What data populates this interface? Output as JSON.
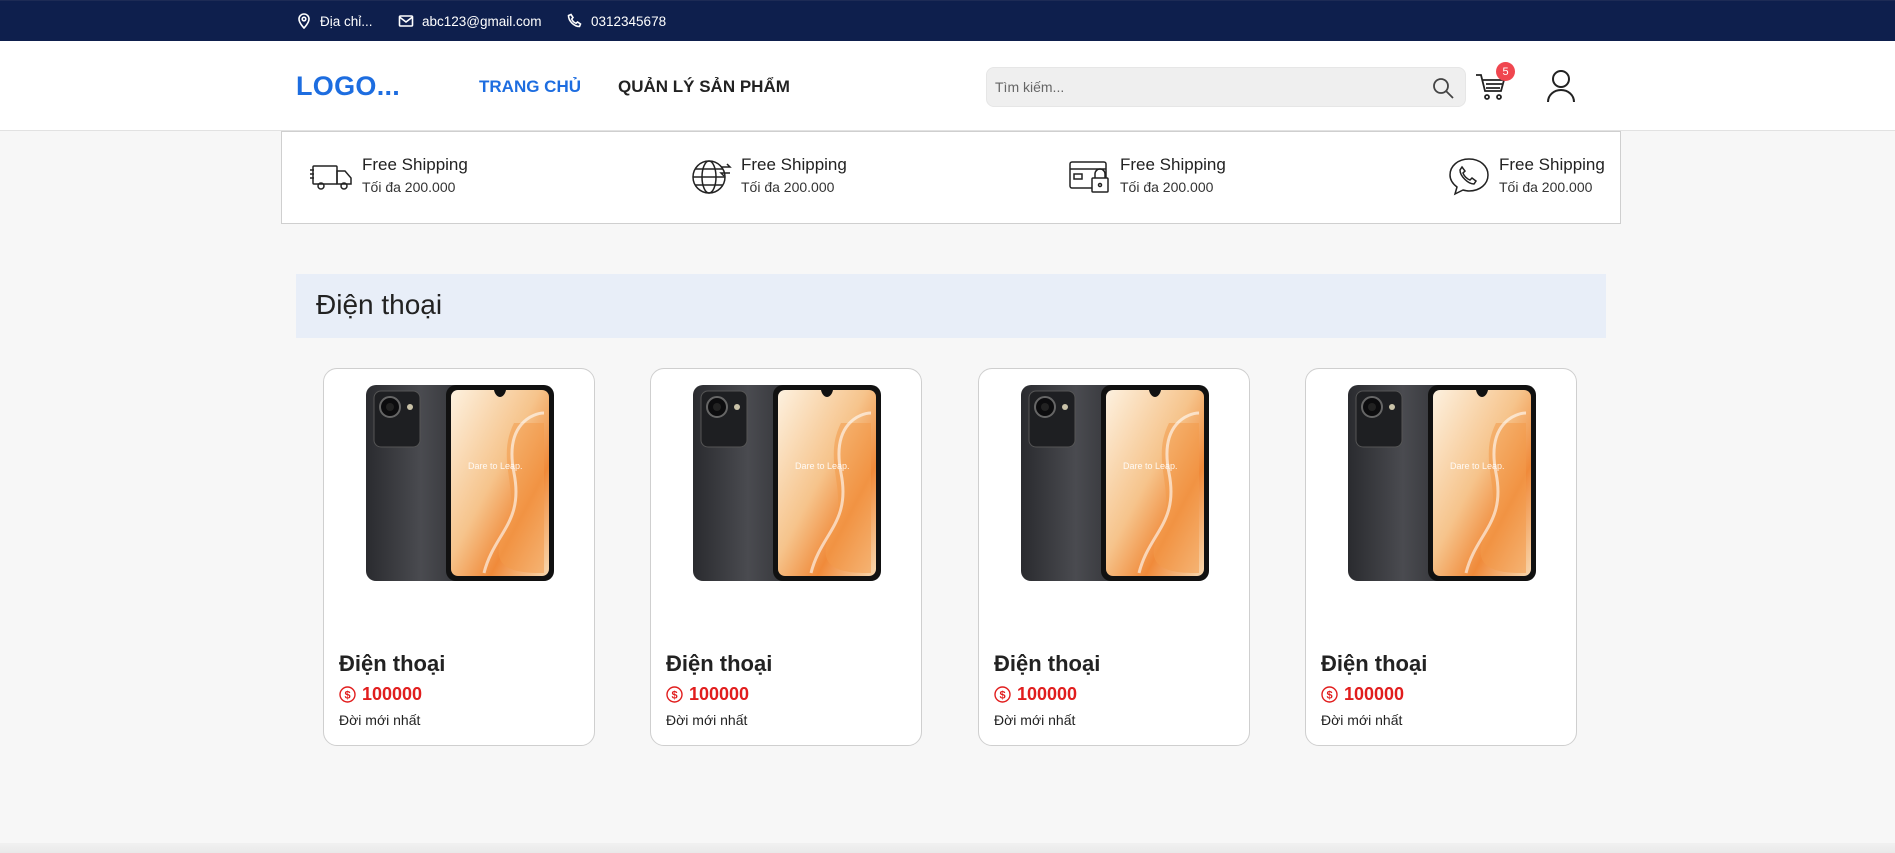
{
  "topbar": {
    "address": "Địa chỉ...",
    "email": "abc123@gmail.com",
    "phone": "0312345678"
  },
  "header": {
    "logo": "LOGO...",
    "nav": [
      {
        "label": "TRANG CHỦ",
        "active": true
      },
      {
        "label": "QUẢN LÝ SẢN PHẨM",
        "active": false
      }
    ],
    "search_placeholder": "Tìm kiếm...",
    "cart_count": "5"
  },
  "features": [
    {
      "icon": "truck-icon",
      "title": "Free Shipping",
      "subtitle": "Tối đa 200.000"
    },
    {
      "icon": "globe-icon",
      "title": "Free Shipping",
      "subtitle": "Tối đa 200.000"
    },
    {
      "icon": "secure-card-icon",
      "title": "Free Shipping",
      "subtitle": "Tối đa 200.000"
    },
    {
      "icon": "phone-call-icon",
      "title": "Free Shipping",
      "subtitle": "Tối đa 200.000"
    }
  ],
  "section": {
    "title": "Điện thoại"
  },
  "products": [
    {
      "name": "Điện thoại",
      "price": "100000",
      "desc": "Đời mới nhất"
    },
    {
      "name": "Điện thoại",
      "price": "100000",
      "desc": "Đời mới nhất"
    },
    {
      "name": "Điện thoại",
      "price": "100000",
      "desc": "Đời mới nhất"
    },
    {
      "name": "Điện thoại",
      "price": "100000",
      "desc": "Đời mới nhất"
    }
  ],
  "colors": {
    "topbar": "#0e1f4d",
    "accent": "#1d6de0",
    "price": "#e11d1d",
    "badge": "#f0464f"
  }
}
